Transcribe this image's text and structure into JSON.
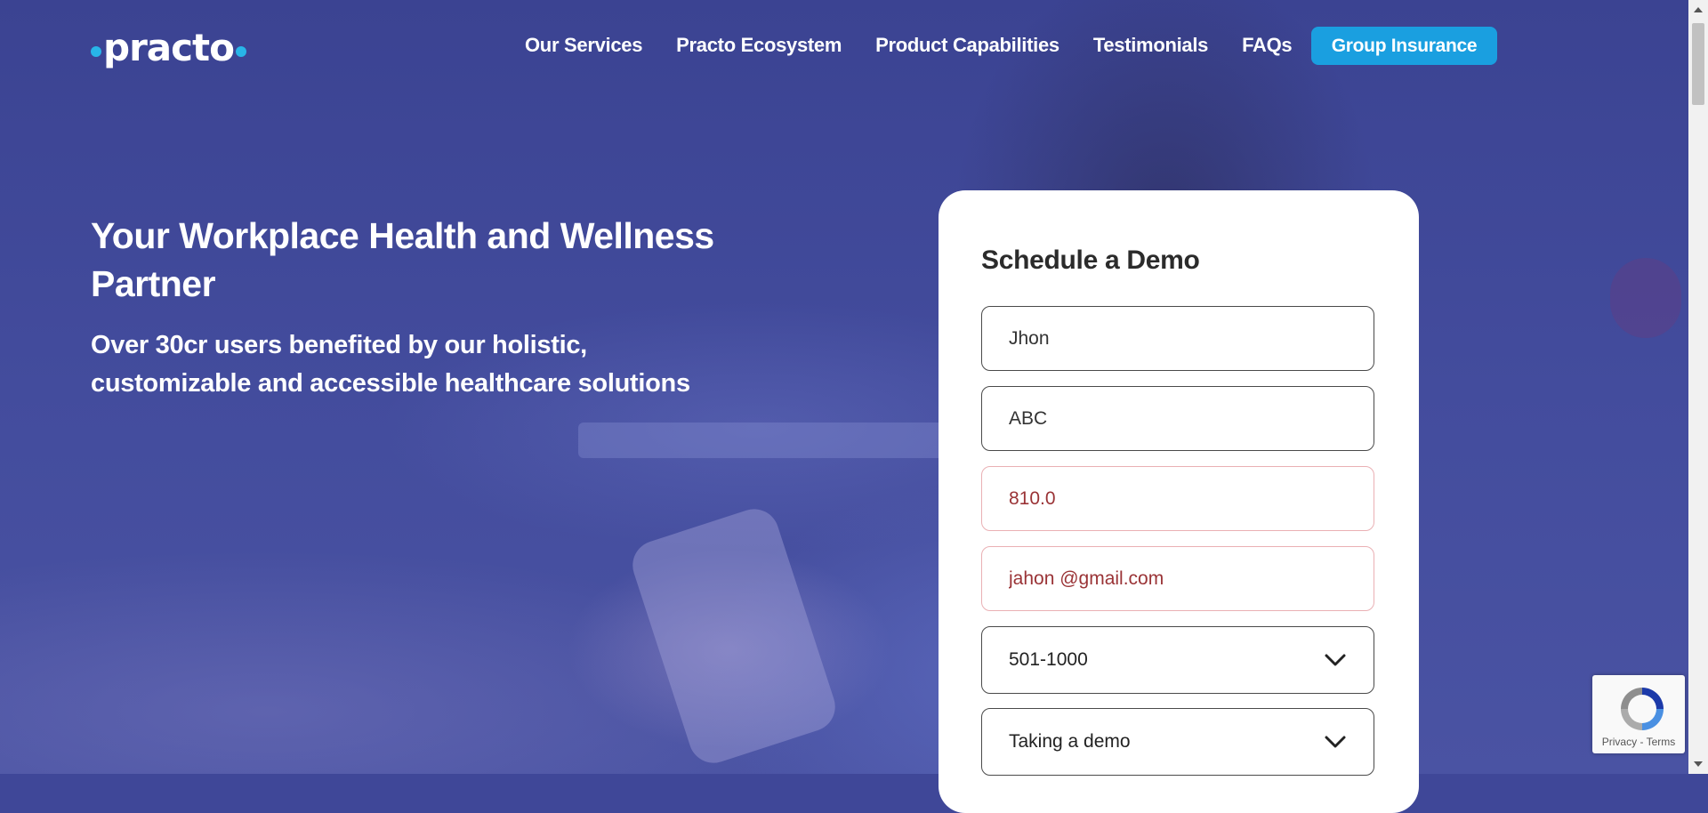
{
  "brand": {
    "logo_text": "practo"
  },
  "nav": {
    "links": [
      "Our Services",
      "Practo Ecosystem",
      "Product Capabilities",
      "Testimonials",
      "FAQs"
    ],
    "cta": "Group Insurance"
  },
  "hero": {
    "title": "Your Workplace Health and Wellness Partner",
    "subtitle": "Over 30cr users benefited by our holistic, customizable and accessible healthcare solutions"
  },
  "form": {
    "title": "Schedule a Demo",
    "name_value": "Jhon",
    "company_value": "ABC",
    "phone_value": "810.0",
    "email_value": "jahon @gmail.com",
    "employees_value": "501-1000",
    "purpose_value": "Taking a demo"
  },
  "recaptcha": {
    "privacy": "Privacy",
    "separator": " - ",
    "terms": "Terms"
  },
  "colors": {
    "hero_overlay": "#3f4798",
    "cta_blue": "#1a9fe0",
    "logo_dot": "#28b5e8",
    "error_border": "#eab0b4",
    "error_text": "#9a3336"
  }
}
